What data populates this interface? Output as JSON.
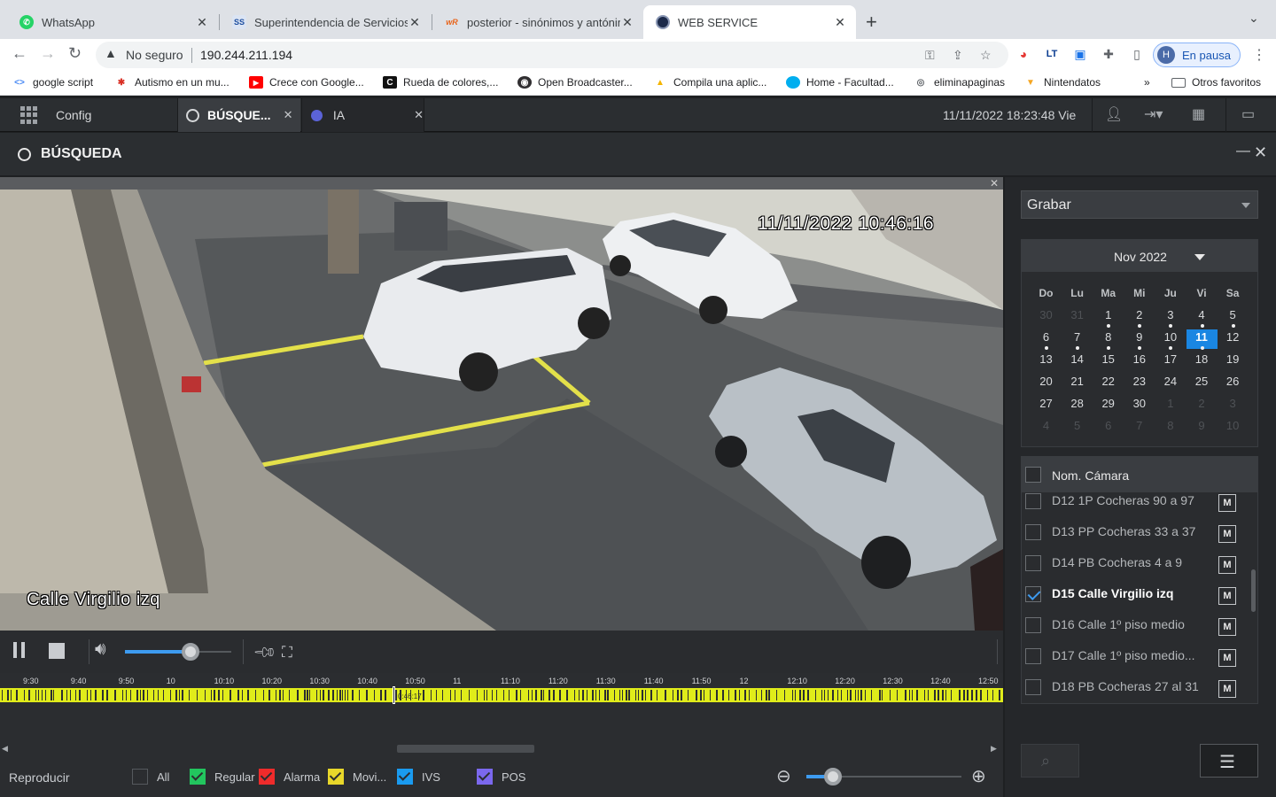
{
  "browser": {
    "tabs": [
      {
        "title": "WhatsApp",
        "icon": "whatsapp-icon",
        "color": "#25d366",
        "glyph": "✆"
      },
      {
        "title": "Superintendencia de Servicios",
        "icon": "sss-icon",
        "color": "#1e4fa0",
        "glyph": "SS"
      },
      {
        "title": "posterior - sinónimos y antónim",
        "icon": "wordreference-icon",
        "color": "#e8641b",
        "glyph": "wR"
      },
      {
        "title": "WEB SERVICE",
        "icon": "web-service-icon",
        "color": "#1c2a4a",
        "glyph": "●"
      }
    ],
    "omnibox": {
      "security": "No seguro",
      "url": "190.244.211.194"
    },
    "profile": {
      "initial": "H",
      "label": "En pausa"
    },
    "bookmarks": [
      {
        "label": "google script",
        "icon": "google-script-icon",
        "color": "#4285f4",
        "glyph": "<>"
      },
      {
        "label": "Autismo en un mu...",
        "icon": "puzzle-bookmark-icon",
        "color": "#d93025",
        "glyph": "✱"
      },
      {
        "label": "Crece con Google...",
        "icon": "youtube-icon",
        "color": "#ff0000",
        "glyph": "▶"
      },
      {
        "label": "Rueda de colores,...",
        "icon": "canva-icon",
        "color": "#111111",
        "glyph": "C"
      },
      {
        "label": "Open Broadcaster...",
        "icon": "obs-icon",
        "color": "#302e31",
        "glyph": "◉"
      },
      {
        "label": "Compila una aplic...",
        "icon": "appsheet-icon",
        "color": "#f4b400",
        "glyph": "▲"
      },
      {
        "label": "Home - Facultad...",
        "icon": "facultad-icon",
        "color": "#00aeef",
        "glyph": "●"
      },
      {
        "label": "eliminapaginas",
        "icon": "globe-icon",
        "color": "#5f6368",
        "glyph": "◎"
      },
      {
        "label": "Nintendatos",
        "icon": "nintendatos-icon",
        "color": "#f5a623",
        "glyph": "▼"
      }
    ],
    "more_bookmarks": "»",
    "other_bookmarks": "Otros favoritos"
  },
  "app": {
    "tabs": [
      {
        "label": "Config"
      },
      {
        "label": "BÚSQUE..."
      },
      {
        "label": "IA"
      }
    ],
    "datetime": "11/11/2022 18:23:48 Vie",
    "page_title": "BÚSQUEDA",
    "video": {
      "osd_time": "11/11/2022 10:46:16",
      "osd_camera": "Calle Virgilio izq"
    },
    "volume_percent": 62,
    "timeline": {
      "ticks": [
        "9:30",
        "9:40",
        "9:50",
        "10",
        "10:10",
        "10:20",
        "10:30",
        "10:40",
        "10:50",
        "11",
        "11:10",
        "11:20",
        "11:30",
        "11:40",
        "11:50",
        "12",
        "12:10",
        "12:20",
        "12:30",
        "12:40",
        "12:50"
      ],
      "cursor_label": "0:46:17"
    },
    "legend": {
      "play_label": "Reproducir",
      "items": [
        {
          "label": "All",
          "color": "#2b2d30"
        },
        {
          "label": "Regular",
          "color": "#22c55e"
        },
        {
          "label": "Alarma",
          "color": "#ef2b2b"
        },
        {
          "label": "Movi...",
          "color": "#e8d72a"
        },
        {
          "label": "IVS",
          "color": "#1a9bf0"
        },
        {
          "label": "POS",
          "color": "#7b68ee"
        }
      ]
    },
    "zoom_percent": 17,
    "record_type": "Grabar",
    "calendar": {
      "month": "Nov 2022",
      "weekdays": [
        "Do",
        "Lu",
        "Ma",
        "Mi",
        "Ju",
        "Vi",
        "Sa"
      ],
      "weeks": [
        [
          {
            "d": "30",
            "dim": true
          },
          {
            "d": "31",
            "dim": true
          },
          {
            "d": "1",
            "dot": true
          },
          {
            "d": "2",
            "dot": true
          },
          {
            "d": "3",
            "dot": true
          },
          {
            "d": "4",
            "dot": true
          },
          {
            "d": "5",
            "dot": true
          }
        ],
        [
          {
            "d": "6",
            "dot": true
          },
          {
            "d": "7",
            "dot": true
          },
          {
            "d": "8",
            "dot": true
          },
          {
            "d": "9",
            "dot": true
          },
          {
            "d": "10",
            "dot": true
          },
          {
            "d": "11",
            "sel": true,
            "dot": true
          },
          {
            "d": "12"
          }
        ],
        [
          {
            "d": "13"
          },
          {
            "d": "14"
          },
          {
            "d": "15"
          },
          {
            "d": "16"
          },
          {
            "d": "17"
          },
          {
            "d": "18"
          },
          {
            "d": "19"
          }
        ],
        [
          {
            "d": "20"
          },
          {
            "d": "21"
          },
          {
            "d": "22"
          },
          {
            "d": "23"
          },
          {
            "d": "24"
          },
          {
            "d": "25"
          },
          {
            "d": "26"
          }
        ],
        [
          {
            "d": "27"
          },
          {
            "d": "28"
          },
          {
            "d": "29"
          },
          {
            "d": "30"
          },
          {
            "d": "1",
            "dim": true
          },
          {
            "d": "2",
            "dim": true
          },
          {
            "d": "3",
            "dim": true
          }
        ],
        [
          {
            "d": "4",
            "dim": true
          },
          {
            "d": "5",
            "dim": true
          },
          {
            "d": "6",
            "dim": true
          },
          {
            "d": "7",
            "dim": true
          },
          {
            "d": "8",
            "dim": true
          },
          {
            "d": "9",
            "dim": true
          },
          {
            "d": "10",
            "dim": true
          }
        ]
      ]
    },
    "camera_list": {
      "header": "Nom. Cámara",
      "cameras": [
        {
          "name": "D12 1P Cocheras 90 a 97",
          "checked": false
        },
        {
          "name": "D13 PP Cocheras 33 a 37",
          "checked": false
        },
        {
          "name": "D14 PB Cocheras 4 a 9",
          "checked": false
        },
        {
          "name": "D15 Calle Virgilio izq",
          "checked": true
        },
        {
          "name": "D16 Calle 1º piso medio",
          "checked": false
        },
        {
          "name": "D17 Calle 1º piso medio...",
          "checked": false
        },
        {
          "name": "D18 PB Cocheras 27 al 31",
          "checked": false
        }
      ],
      "mark_label": "M"
    }
  }
}
